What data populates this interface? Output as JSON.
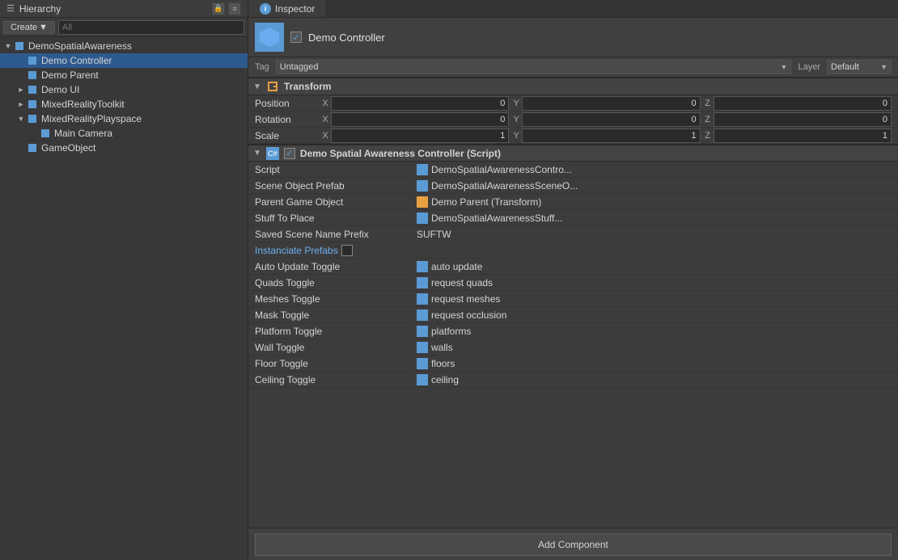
{
  "hierarchy": {
    "title": "Hierarchy",
    "create_btn": "Create",
    "search_placeholder": "All",
    "items": [
      {
        "id": "root",
        "label": "DemoSpatialAwareness",
        "level": 0,
        "expanded": true,
        "has_arrow": true,
        "selected": false
      },
      {
        "id": "demo-controller",
        "label": "Demo Controller",
        "level": 1,
        "expanded": false,
        "has_arrow": false,
        "selected": true
      },
      {
        "id": "demo-parent",
        "label": "Demo Parent",
        "level": 1,
        "expanded": false,
        "has_arrow": false,
        "selected": false
      },
      {
        "id": "demo-ui",
        "label": "Demo UI",
        "level": 1,
        "expanded": false,
        "has_arrow": true,
        "selected": false
      },
      {
        "id": "mrt",
        "label": "MixedRealityToolkit",
        "level": 1,
        "expanded": false,
        "has_arrow": true,
        "selected": false
      },
      {
        "id": "mrp",
        "label": "MixedRealityPlayspace",
        "level": 1,
        "expanded": true,
        "has_arrow": true,
        "selected": false
      },
      {
        "id": "main-camera",
        "label": "Main Camera",
        "level": 2,
        "expanded": false,
        "has_arrow": false,
        "selected": false
      },
      {
        "id": "gameobject",
        "label": "GameObject",
        "level": 1,
        "expanded": false,
        "has_arrow": false,
        "selected": false
      }
    ]
  },
  "inspector": {
    "tab_label": "Inspector",
    "object": {
      "name": "Demo Controller",
      "enabled": true,
      "tag": "Untagged",
      "layer": "Default"
    },
    "transform": {
      "section_title": "Transform",
      "position": {
        "label": "Position",
        "x": "0",
        "y": "0",
        "z": "0"
      },
      "rotation": {
        "label": "Rotation",
        "x": "0",
        "y": "0",
        "z": "0"
      },
      "scale": {
        "label": "Scale",
        "x": "1",
        "y": "1",
        "z": "1"
      }
    },
    "script_component": {
      "section_title": "Demo Spatial Awareness Controller (Script)",
      "fields": [
        {
          "label": "Script",
          "value": "DemoSpatialAwarenessContro...",
          "type": "asset"
        },
        {
          "label": "Scene Object Prefab",
          "value": "DemoSpatialAwarenessSceneO...",
          "type": "asset"
        },
        {
          "label": "Parent Game Object",
          "value": "Demo Parent (Transform)",
          "type": "asset-transform"
        },
        {
          "label": "Stuff To Place",
          "value": "DemoSpatialAwarenessStuff...",
          "type": "asset"
        },
        {
          "label": "Saved Scene Name Prefix",
          "value": "SUFTW",
          "type": "text"
        },
        {
          "label": "Instanciate Prefabs",
          "value": "",
          "type": "link-checkbox"
        },
        {
          "label": "Auto Update Toggle",
          "value": "auto update",
          "type": "asset"
        },
        {
          "label": "Quads Toggle",
          "value": "request quads",
          "type": "asset"
        },
        {
          "label": "Meshes Toggle",
          "value": "request meshes",
          "type": "asset"
        },
        {
          "label": "Mask Toggle",
          "value": "request occlusion",
          "type": "asset"
        },
        {
          "label": "Platform Toggle",
          "value": "platforms",
          "type": "asset"
        },
        {
          "label": "Wall Toggle",
          "value": "walls",
          "type": "asset"
        },
        {
          "label": "Floor Toggle",
          "value": "floors",
          "type": "asset"
        },
        {
          "label": "Ceiling Toggle",
          "value": "ceiling",
          "type": "asset"
        }
      ]
    },
    "add_component_label": "Add Component"
  }
}
